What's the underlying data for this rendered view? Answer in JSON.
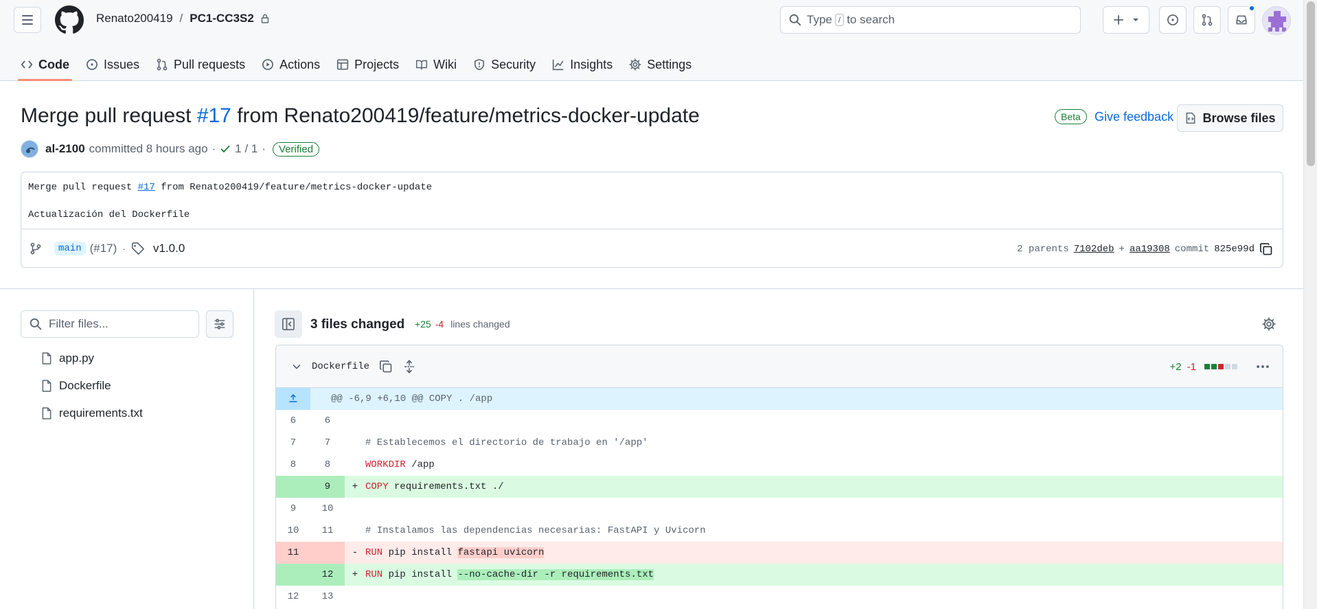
{
  "header": {
    "owner": "Renato200419",
    "separator": "/",
    "repo": "PC1-CC3S2",
    "search_prefix": "Type",
    "search_key": "/",
    "search_suffix": "to search"
  },
  "nav": {
    "tabs": [
      {
        "label": "Code",
        "icon": "code-icon",
        "active": true
      },
      {
        "label": "Issues",
        "icon": "issue-icon"
      },
      {
        "label": "Pull requests",
        "icon": "pull-request-icon"
      },
      {
        "label": "Actions",
        "icon": "play-icon"
      },
      {
        "label": "Projects",
        "icon": "table-icon"
      },
      {
        "label": "Wiki",
        "icon": "book-icon"
      },
      {
        "label": "Security",
        "icon": "shield-icon"
      },
      {
        "label": "Insights",
        "icon": "graph-icon"
      },
      {
        "label": "Settings",
        "icon": "gear-icon"
      }
    ]
  },
  "commit": {
    "title_prefix": "Merge pull request ",
    "title_pr": "#17",
    "title_suffix": " from Renato200419/feature/metrics-docker-update",
    "beta": "Beta",
    "feedback": "Give feedback",
    "browse": "Browse files",
    "author": "al-2100",
    "committed": "committed 8 hours ago",
    "dot": "·",
    "checks": "1 / 1",
    "verified": "Verified",
    "message_line1_prefix": "Merge pull request ",
    "message_line1_pr": "#17",
    "message_line1_suffix": " from Renato200419/feature/metrics-docker-update",
    "message_line2": "Actualización del Dockerfile",
    "branch": "main",
    "branch_pr": "(#17)",
    "tag": "v1.0.0",
    "parents_label": "2 parents",
    "parent1": "7102deb",
    "plus": "+",
    "parent2": "aa19308",
    "commit_label": "commit",
    "sha": "825e99d"
  },
  "sidebar": {
    "filter_placeholder": "Filter files...",
    "files": [
      "app.py",
      "Dockerfile",
      "requirements.txt"
    ]
  },
  "diff": {
    "files_changed": "3 files changed",
    "additions": "+25",
    "deletions": "-4",
    "lines_changed": "lines changed",
    "file": {
      "name": "Dockerfile",
      "additions": "+2",
      "deletions": "-1",
      "blocks": [
        "add",
        "add",
        "del",
        "neutral",
        "neutral"
      ]
    },
    "hunk": "@@ -6,9 +6,10 @@ COPY . /app",
    "lines": [
      {
        "type": "ctx",
        "old": "6",
        "new": "6",
        "sign": "",
        "parts": [
          {
            "t": ""
          }
        ]
      },
      {
        "type": "ctx",
        "old": "7",
        "new": "7",
        "sign": "",
        "parts": [
          {
            "t": "# Establecemos el directorio de trabajo en '/app'",
            "c": "cm"
          }
        ]
      },
      {
        "type": "ctx",
        "old": "8",
        "new": "8",
        "sign": "",
        "parts": [
          {
            "t": "WORKDIR",
            "c": "kw"
          },
          {
            "t": " /app"
          }
        ]
      },
      {
        "type": "add",
        "old": "",
        "new": "9",
        "sign": "+",
        "parts": [
          {
            "t": "COPY",
            "c": "kw"
          },
          {
            "t": " requirements.txt ./"
          }
        ]
      },
      {
        "type": "ctx",
        "old": "9",
        "new": "10",
        "sign": "",
        "parts": [
          {
            "t": ""
          }
        ]
      },
      {
        "type": "ctx",
        "old": "10",
        "new": "11",
        "sign": "",
        "parts": [
          {
            "t": "# Instalamos las dependencias necesarias: FastAPI y Uvicorn",
            "c": "cm"
          }
        ]
      },
      {
        "type": "del",
        "old": "11",
        "new": "",
        "sign": "-",
        "parts": [
          {
            "t": "RUN",
            "c": "kw"
          },
          {
            "t": " pip install "
          },
          {
            "t": "fastapi uvicorn",
            "c": "hl-del"
          }
        ]
      },
      {
        "type": "add",
        "old": "",
        "new": "12",
        "sign": "+",
        "parts": [
          {
            "t": "RUN",
            "c": "kw"
          },
          {
            "t": " pip install "
          },
          {
            "t": "--no-cache-dir -r requirements.txt",
            "c": "hl-add"
          }
        ]
      },
      {
        "type": "ctx",
        "old": "12",
        "new": "13",
        "sign": "",
        "parts": [
          {
            "t": ""
          }
        ]
      }
    ]
  },
  "colors": {
    "link": "#0969da",
    "success": "#1a7f37",
    "danger": "#d1242f",
    "active_tab_underline": "#fd8c73"
  }
}
